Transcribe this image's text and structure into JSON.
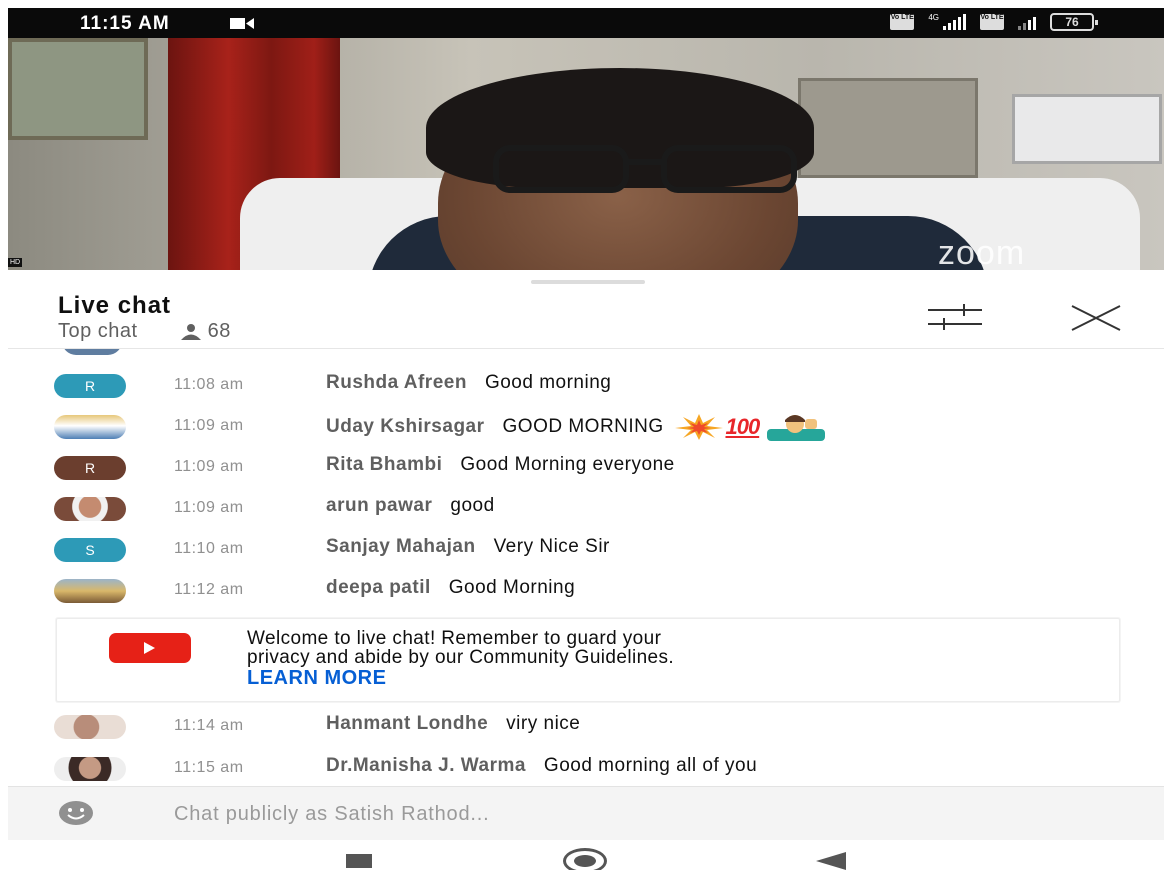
{
  "status_bar": {
    "time": "11:15 AM",
    "volte_label": "Vo LTE",
    "network_type": "4G",
    "battery": "76",
    "icons": [
      "video-recording-icon",
      "volte-icon",
      "signal-icon",
      "battery-icon"
    ]
  },
  "video": {
    "watermark": "zoom",
    "quality_badge": "HD",
    "progress_color": "#e62117"
  },
  "chat": {
    "title": "Live chat",
    "mode": "Top chat",
    "viewers": "68",
    "messages": [
      {
        "time": "11:08 am",
        "author": "Rushda Afreen",
        "text": "Good morning",
        "avatar_letter": "R",
        "avatar_color": "#2d9ab7"
      },
      {
        "time": "11:09 am",
        "author": "Uday Kshirsagar",
        "text": "GOOD MORNING",
        "avatar_letter": "",
        "avatar_color": "#8aa0b6"
      },
      {
        "time": "11:09 am",
        "author": "Rita Bhambi",
        "text": "Good Morning everyone",
        "avatar_letter": "R",
        "avatar_color": "#6b3e2e"
      },
      {
        "time": "11:09 am",
        "author": "arun pawar",
        "text": "good",
        "avatar_letter": "",
        "avatar_color": "#b58a73"
      },
      {
        "time": "11:10 am",
        "author": "Sanjay Mahajan",
        "text": "Very Nice Sir",
        "avatar_letter": "S",
        "avatar_color": "#2d9ab7"
      },
      {
        "time": "11:12 am",
        "author": "deepa patil",
        "text": "Good Morning",
        "avatar_letter": "",
        "avatar_color": "#b99a5d"
      },
      {
        "time": "11:14 am",
        "author": "Hanmant Londhe",
        "text": "viry nice",
        "avatar_letter": "",
        "avatar_color": "#d3b9a8"
      },
      {
        "time": "11:15 am",
        "author": "Dr.Manisha J. Warma",
        "text": "Good morning all of you",
        "avatar_letter": "",
        "avatar_color": "#7a5a4c"
      }
    ],
    "emoji": {
      "collision": "collision-emoji",
      "hundred": "100",
      "person": "person-gesturing-emoji"
    },
    "welcome": {
      "line1": "Welcome to live chat! Remember to guard your",
      "line2": "privacy and abide by our Community Guidelines.",
      "link": "LEARN MORE"
    },
    "input_placeholder": "Chat publicly as Satish Rathod..."
  },
  "nav": {
    "recent": "recent-apps-icon",
    "home": "home-icon",
    "back": "back-icon"
  }
}
